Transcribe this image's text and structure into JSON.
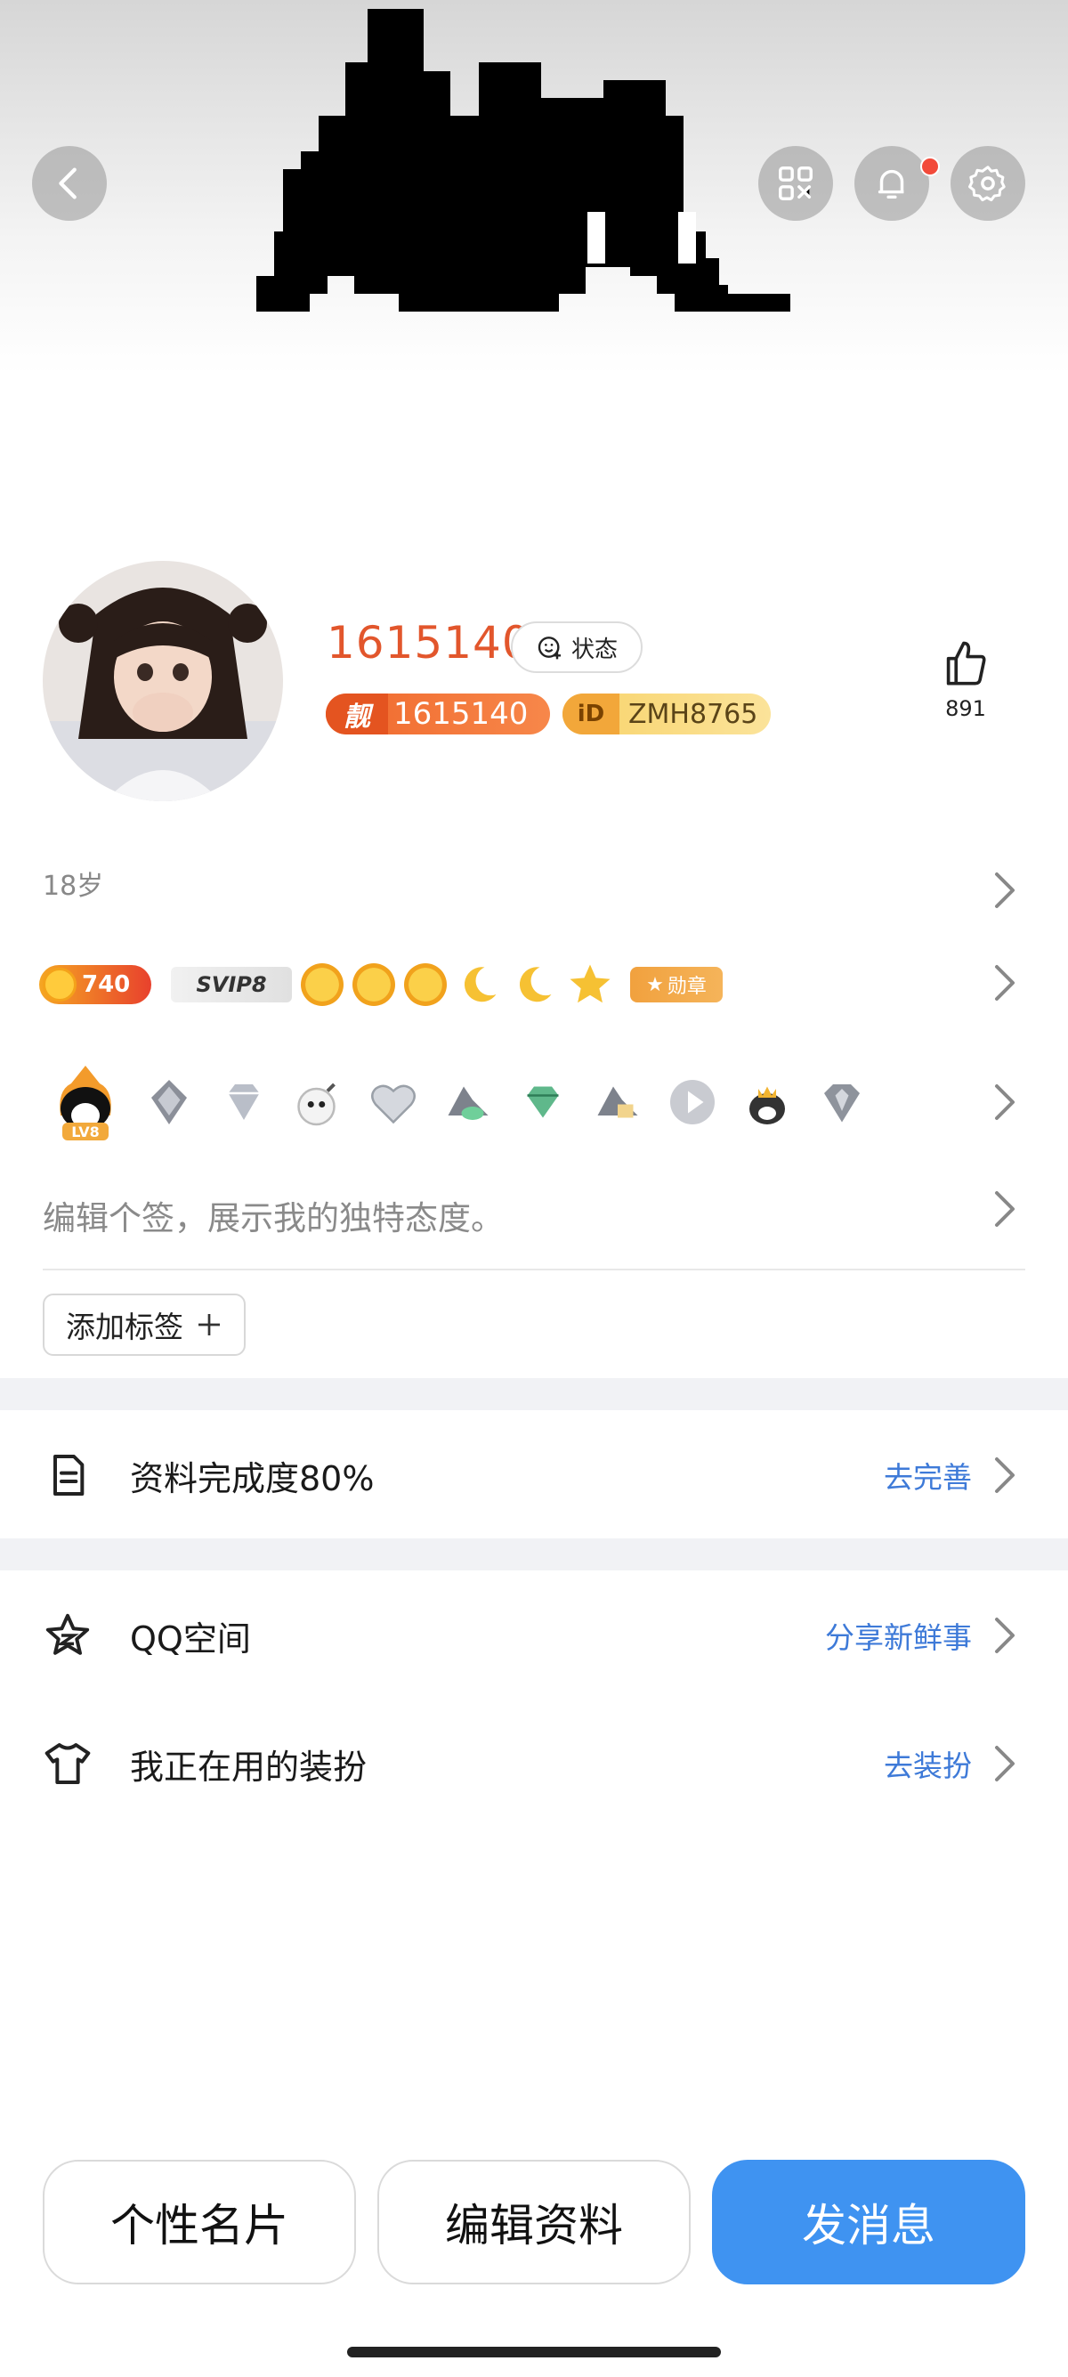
{
  "header": {
    "back_icon": "chevron-left-icon",
    "qr_icon": "qr-code-icon",
    "bell_icon": "bell-icon",
    "settings_icon": "gear-icon"
  },
  "profile": {
    "nickname": "1615140",
    "status_label": "状态",
    "pretty_number_icon_text": "靓",
    "pretty_number": "1615140",
    "qid_icon_text": "iD",
    "qid": "ZMH8765",
    "likes": "891"
  },
  "info": {
    "age": "18岁",
    "level_number": "740",
    "svip_label": "SVIP8",
    "medal_label": "勋章",
    "signature_placeholder": "编辑个签，展示我的独特态度。",
    "add_tag_label": "添加标签",
    "add_tag_icon": "plus-icon",
    "badge_icon_level_text": "LV8"
  },
  "rows": [
    {
      "label": "资料完成度80%",
      "link": "去完善",
      "icon": "document-icon"
    },
    {
      "label": "QQ空间",
      "link": "分享新鲜事",
      "icon": "star-outline-icon"
    },
    {
      "label": "我正在用的装扮",
      "link": "去装扮",
      "icon": "tshirt-icon"
    }
  ],
  "bottom_buttons": {
    "card": "个性名片",
    "edit": "编辑资料",
    "message": "发消息"
  },
  "colors": {
    "accent_blue": "#3f93f1",
    "link_blue": "#3e7ad8",
    "nick_orange": "#e2562c",
    "notification_red": "#f24a3a"
  }
}
